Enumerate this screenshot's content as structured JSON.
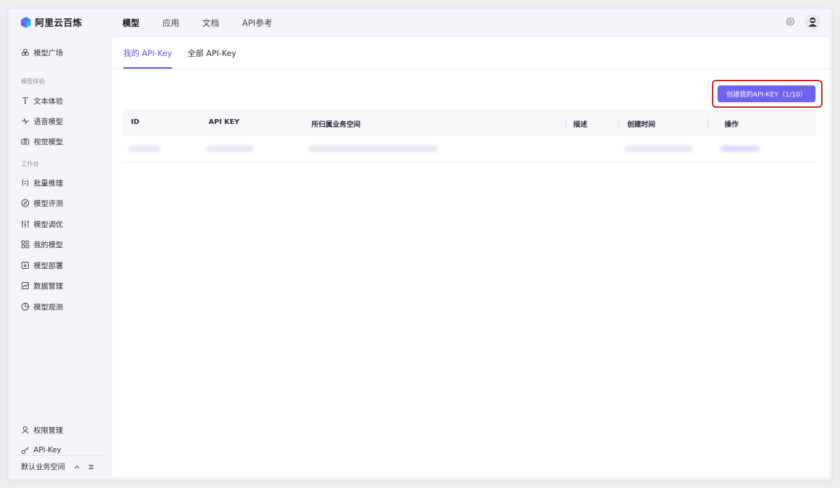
{
  "brand": {
    "name": "阿里云百炼"
  },
  "topnav": {
    "items": [
      "模型",
      "应用",
      "文档",
      "API参考"
    ],
    "active_index": 0
  },
  "sidebar": {
    "model_plaza": "模型广场",
    "group_experience": "模型体验",
    "text_experience": "文本体验",
    "voice_model": "语音模型",
    "vision_model": "视觉模型",
    "group_workbench": "工作台",
    "batch_inference": "批量推理",
    "model_eval": "模型评测",
    "model_tuning": "模型调优",
    "my_models": "我的模型",
    "model_deploy": "模型部署",
    "data_manage": "数据管理",
    "model_observe": "模型观测",
    "permission_manage": "权限管理",
    "api_key": "API-Key",
    "workspace": "默认业务空间"
  },
  "tabs": {
    "mine": "我的 API-Key",
    "all": "全部 API-Key",
    "active": "mine"
  },
  "create_button": {
    "label": "创建我的API-KEY（1/10）"
  },
  "table": {
    "columns": [
      "ID",
      "API KEY",
      "所归属业务空间",
      "描述",
      "创建时间",
      "操作"
    ]
  },
  "colors": {
    "accent": "#5b55e6",
    "button": "#6e62ee",
    "highlight": "#d61f2c"
  }
}
